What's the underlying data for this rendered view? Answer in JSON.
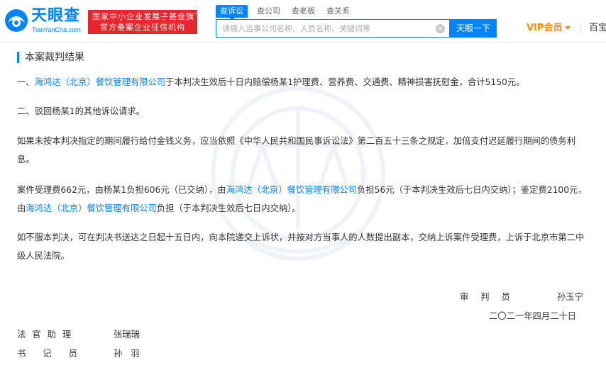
{
  "header": {
    "logo_title": "天眼查",
    "logo_domain": "TianYanCha.com",
    "badge_line1": "国家中小企业发展子基金旗下",
    "badge_line2": "官方备案企业征信机构",
    "tabs": [
      {
        "label": "查诉讼",
        "active": true
      },
      {
        "label": "查公司",
        "active": false
      },
      {
        "label": "查老板",
        "active": false
      },
      {
        "label": "查关系",
        "active": false
      }
    ],
    "search_placeholder": "请输入当事公司名称、人员名称、关键词等",
    "search_button": "天眼一下",
    "vip_label": "VIP会员",
    "baibao_label": "百宝"
  },
  "content": {
    "section_title": "本案裁判结果",
    "p1": {
      "prefix": "一、",
      "company": "海鸿达（北京）餐饮管理有限公司",
      "rest": "于本判决生效后十日内赔偿杨某1护理费、营养费、交通费、精神损害抚慰金，合计5150元。"
    },
    "p2": "二、驳回杨某1的其他诉讼请求。",
    "p3": "如果未按本判决指定的期间履行给付金钱义务，应当依照《中华人民共和国民事诉讼法》第二百五十三条之规定，加倍支付迟延履行期间的债务利息。",
    "p4": {
      "part1": "案件受理费662元，由杨某1负担606元（已交纳），由",
      "company1": "海鸿达（北京）餐饮管理有限公司",
      "part2": "负担56元（于本判决生效后七日内交纳）；鉴定费2100元，由",
      "company2": "海鸿达（北京）餐饮管理有限公司",
      "part3": "负担（于本判决生效后七日内交纳）。"
    },
    "p5": "如不服本判决，可在判决书送达之日起十五日内，向本院递交上诉状，并按对方当事人的人数提出副本，交纳上诉案件受理费，上诉于北京市第二中级人民法院。"
  },
  "signatures": {
    "judge_title": "审判员",
    "judge_name": "孙玉宁",
    "date": "二〇二一年四月二十日",
    "assistant_title": "法官助理",
    "assistant_name": "张瑞瑞",
    "clerk_title": "书记员",
    "clerk_name": "孙羽"
  },
  "colors": {
    "brand_blue": "#0084ff",
    "badge_red": "#e8262d",
    "vip_orange": "#ff8a00"
  }
}
